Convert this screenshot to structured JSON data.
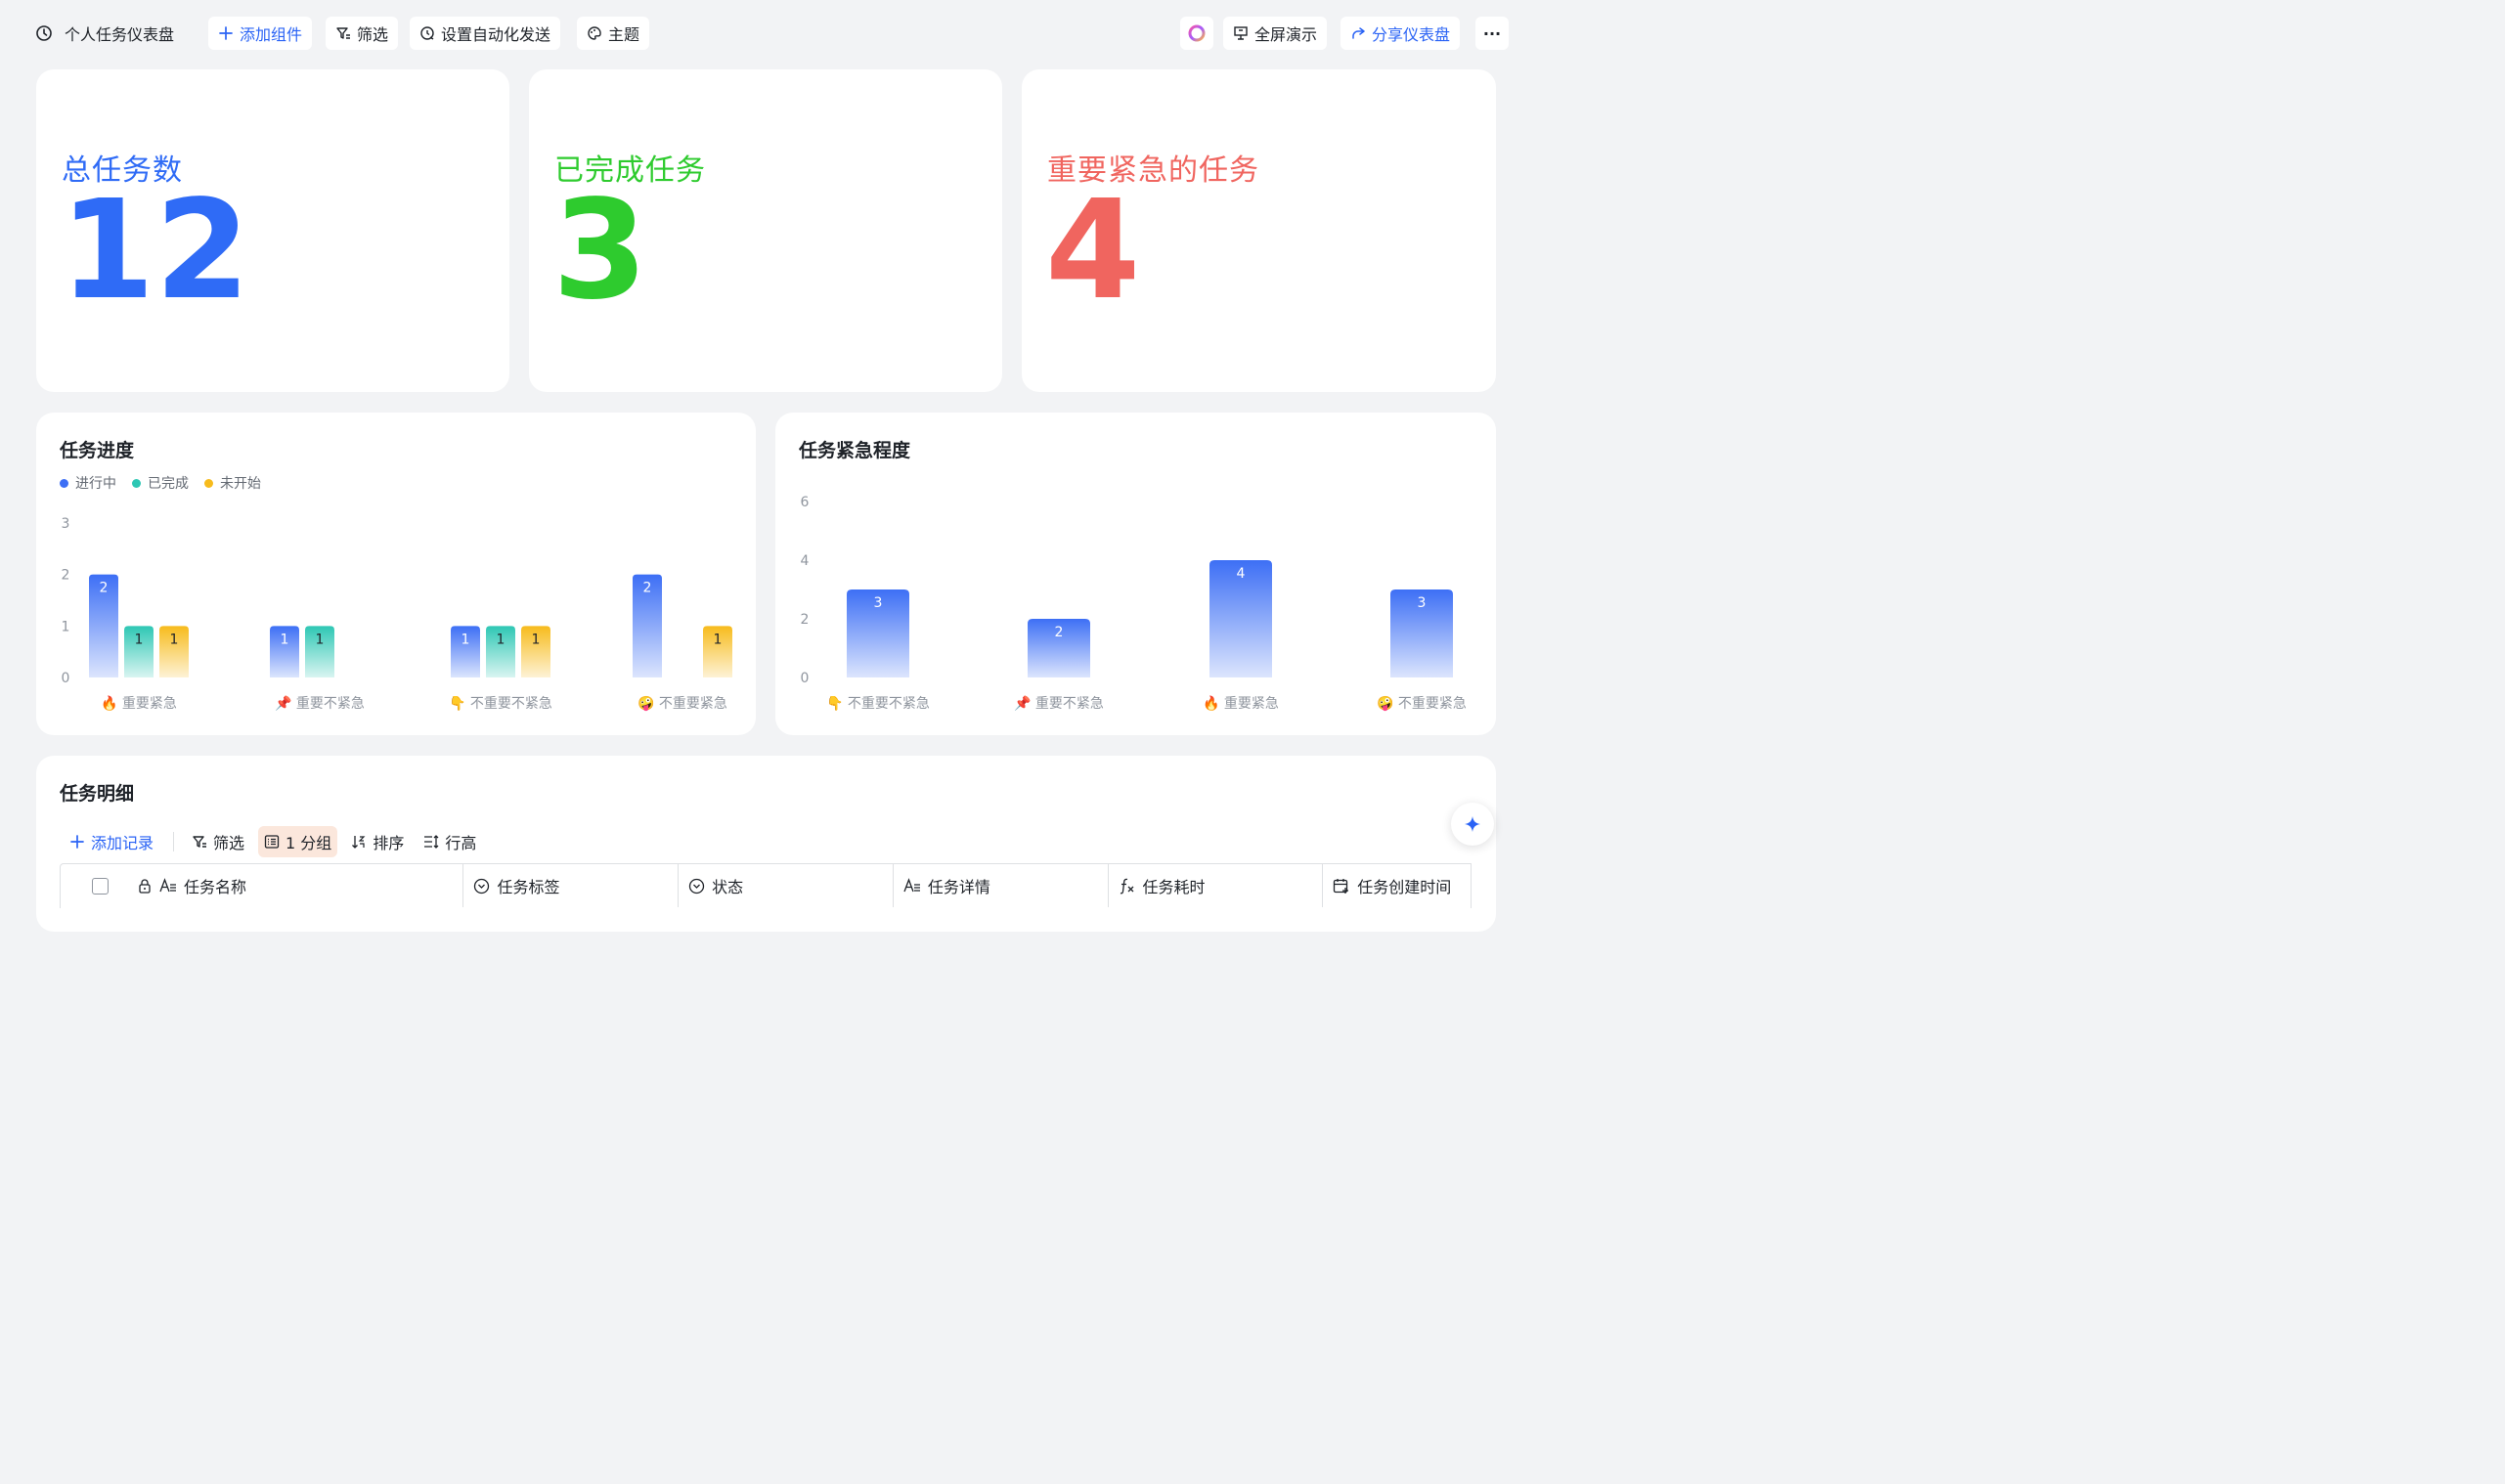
{
  "toolbar": {
    "title": "个人任务仪表盘",
    "add_widget": "添加组件",
    "filter": "筛选",
    "auto_send": "设置自动化发送",
    "theme": "主题",
    "fullscreen": "全屏演示",
    "share": "分享仪表盘",
    "more": "···"
  },
  "kpis": [
    {
      "label": "总任务数",
      "value": "12",
      "color": "#2f6bf6"
    },
    {
      "label": "已完成任务",
      "value": "3",
      "color": "#2ecb2e"
    },
    {
      "label": "重要紧急的任务",
      "value": "4",
      "color": "#f0655f"
    }
  ],
  "progress_chart": {
    "title": "任务进度",
    "legend": [
      "进行中",
      "已完成",
      "未开始"
    ]
  },
  "urgency_chart": {
    "title": "任务紧急程度"
  },
  "chart_data": [
    {
      "type": "bar",
      "title": "任务进度",
      "categories": [
        "🔥 重要紧急",
        "📌 重要不紧急",
        "👇 不重要不紧急",
        "🤪 不重要紧急"
      ],
      "series": [
        {
          "name": "进行中",
          "values": [
            2,
            1,
            1,
            2
          ],
          "color": "#3d6ff5"
        },
        {
          "name": "已完成",
          "values": [
            1,
            1,
            1,
            0
          ],
          "color": "#2ec7b4"
        },
        {
          "name": "未开始",
          "values": [
            1,
            0,
            1,
            1
          ],
          "color": "#f7bb1c"
        }
      ],
      "yticks": [
        "0",
        "1",
        "2",
        "3"
      ],
      "ylim": [
        0,
        3
      ],
      "grid": false,
      "legend_position": "top-left"
    },
    {
      "type": "bar",
      "title": "任务紧急程度",
      "categories": [
        "👇 不重要不紧急",
        "📌 重要不紧急",
        "🔥 重要紧急",
        "🤪 不重要紧急"
      ],
      "values": [
        3,
        2,
        4,
        3
      ],
      "color": "#3d6ff5",
      "yticks": [
        "0",
        "2",
        "4",
        "6"
      ],
      "ylim": [
        0,
        6
      ],
      "grid": false
    }
  ],
  "table": {
    "title": "任务明细",
    "tools": {
      "add_record": "添加记录",
      "filter": "筛选",
      "group": "1 分组",
      "sort": "排序",
      "row_height": "行高"
    },
    "columns": [
      "任务名称",
      "任务标签",
      "状态",
      "任务详情",
      "任务耗时",
      "任务创建时间"
    ]
  },
  "colors": {
    "accent": "#2a63f5",
    "background": "#f2f3f5"
  }
}
